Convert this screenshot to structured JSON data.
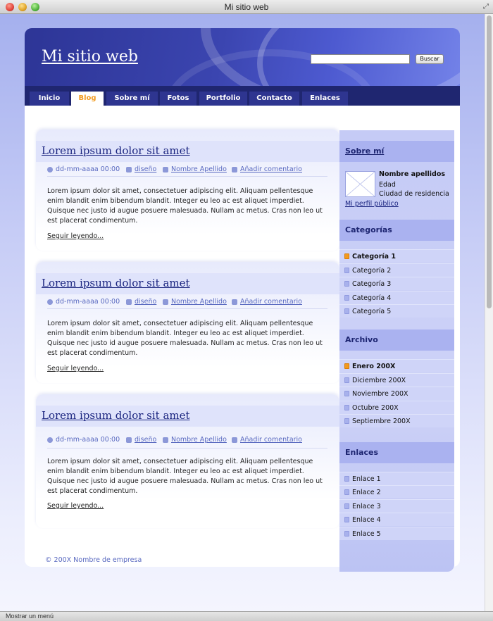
{
  "window": {
    "title": "Mi sitio web"
  },
  "statusbar": {
    "text": "Mostrar un menú"
  },
  "site": {
    "title": "Mi sitio web"
  },
  "search": {
    "placeholder": "",
    "button_label": "Buscar"
  },
  "nav": {
    "tabs": [
      {
        "label": "Inicio"
      },
      {
        "label": "Blog",
        "active": true
      },
      {
        "label": "Sobre mí"
      },
      {
        "label": "Fotos"
      },
      {
        "label": "Portfolio"
      },
      {
        "label": "Contacto"
      },
      {
        "label": "Enlaces"
      }
    ]
  },
  "posts": [
    {
      "title": "Lorem ipsum dolor sit amet",
      "date": "dd-mm-aaaa 00:00",
      "category": "diseño",
      "author": "Nombre Apellido",
      "comment_link": "Añadir comentario",
      "body": "Lorem ipsum dolor sit amet, consectetuer adipiscing elit. Aliquam pellentesque enim blandit enim bibendum blandit. Integer eu leo ac est aliquet imperdiet. Quisque nec justo id augue posuere malesuada. Nullam ac metus. Cras non leo ut est placerat condimentum.",
      "read_more": "Seguir leyendo..."
    },
    {
      "title": "Lorem ipsum dolor sit amet",
      "date": "dd-mm-aaaa 00:00",
      "category": "diseño",
      "author": "Nombre Apellido",
      "comment_link": "Añadir comentario",
      "body": "Lorem ipsum dolor sit amet, consectetuer adipiscing elit. Aliquam pellentesque enim blandit enim bibendum blandit. Integer eu leo ac est aliquet imperdiet. Quisque nec justo id augue posuere malesuada. Nullam ac metus. Cras non leo ut est placerat condimentum.",
      "read_more": "Seguir leyendo..."
    },
    {
      "title": "Lorem ipsum dolor sit amet",
      "date": "dd-mm-aaaa 00:00",
      "category": "diseño",
      "author": "Nombre Apellido",
      "comment_link": "Añadir comentario",
      "body": "Lorem ipsum dolor sit amet, consectetuer adipiscing elit. Aliquam pellentesque enim blandit enim bibendum blandit. Integer eu leo ac est aliquet imperdiet. Quisque nec justo id augue posuere malesuada. Nullam ac metus. Cras non leo ut est placerat condimentum.",
      "read_more": "Seguir leyendo..."
    }
  ],
  "sidebar": {
    "about": {
      "heading": "Sobre mí",
      "name": "Nombre apellidos",
      "age": "Edad",
      "city": "Ciudad de residencia",
      "profile_link": "Mi perfil público"
    },
    "categories": {
      "heading": "Categorías",
      "items": [
        "Categoría 1",
        "Categoría 2",
        "Categoría 3",
        "Categoría 4",
        "Categoría 5"
      ]
    },
    "archive": {
      "heading": "Archivo",
      "items": [
        "Enero 200X",
        "Diciembre 200X",
        "Noviembre 200X",
        "Octubre 200X",
        "Septiembre 200X"
      ]
    },
    "links": {
      "heading": "Enlaces",
      "items": [
        "Enlace 1",
        "Enlace 2",
        "Enlace 3",
        "Enlace 4",
        "Enlace 5"
      ]
    }
  },
  "footer": {
    "text": "© 200X Nombre de empresa"
  },
  "colors": {
    "accent": "#f29a1e",
    "header_dark": "#2d3596",
    "nav_bg": "#1f2670",
    "link": "#1b2580"
  }
}
